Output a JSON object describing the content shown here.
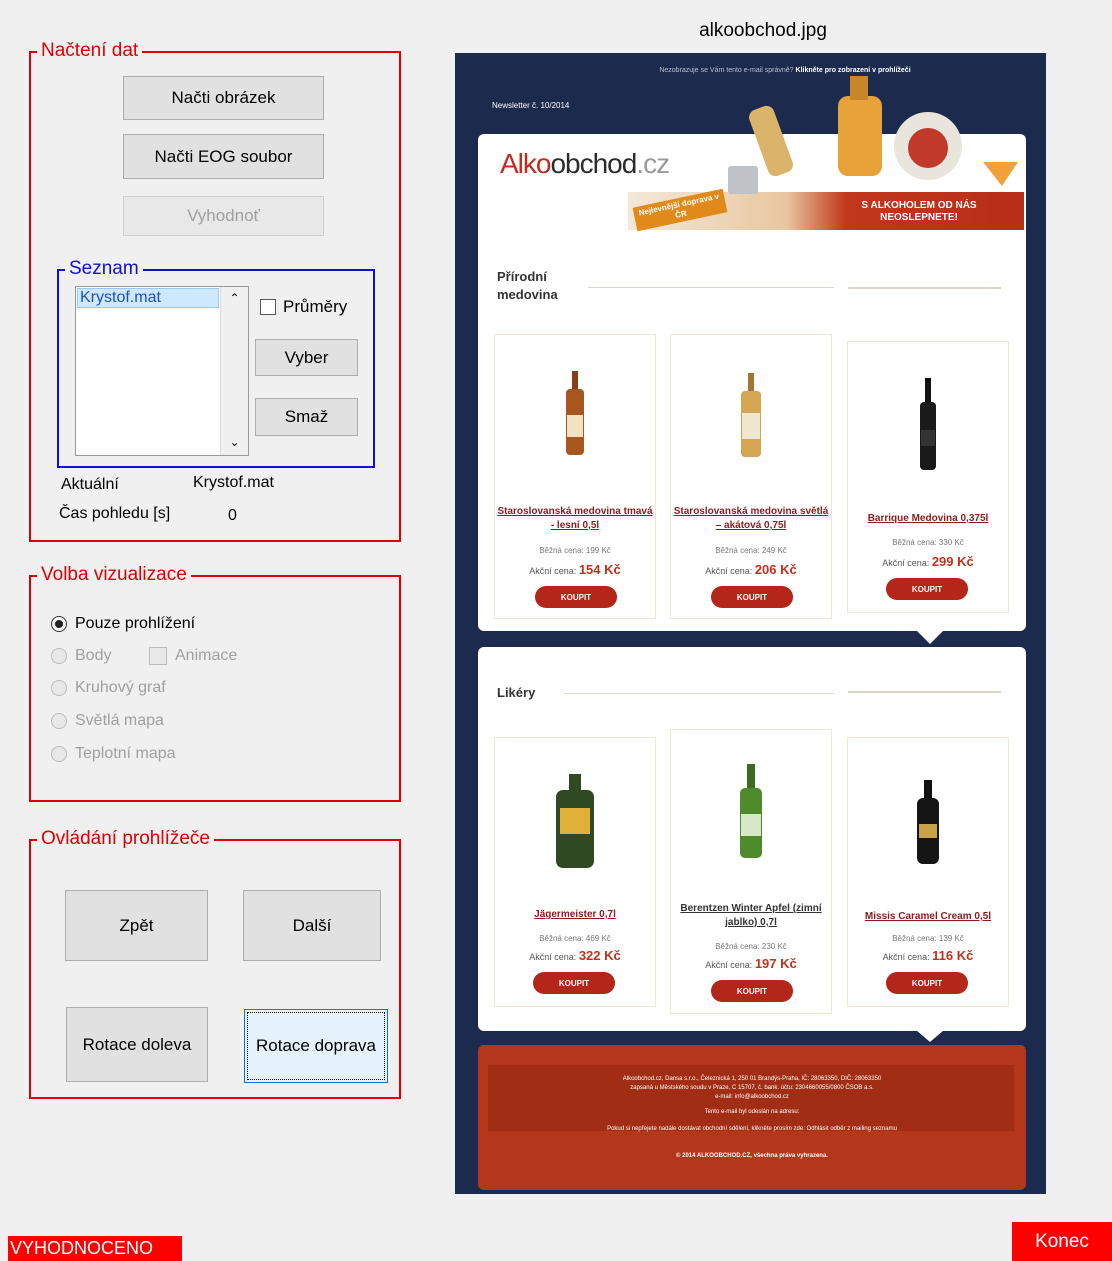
{
  "image_title": "alkoobchod.jpg",
  "nacteni": {
    "title": "Načtení dat",
    "btn_load_image": "Načti obrázek",
    "btn_load_eog": "Načti EOG soubor",
    "btn_evaluate": "Vyhodnoť",
    "seznam": {
      "title": "Seznam",
      "items": [
        "Krystof.mat"
      ],
      "chk_prumery": "Průměry",
      "btn_vyber": "Vyber",
      "btn_smaz": "Smaž"
    },
    "aktualni_label": "Aktuální",
    "aktualni_value": "Krystof.mat",
    "cas_label": "Čas pohledu [s]",
    "cas_value": "0"
  },
  "vizualizace": {
    "title": "Volba vizualizace",
    "options": [
      "Pouze prohlížení",
      "Body",
      "Kruhový graf",
      "Světlá mapa",
      "Teplotní mapa"
    ],
    "selected": "Pouze prohlížení",
    "chk_animace": "Animace"
  },
  "ovladani": {
    "title": "Ovládání prohlížeče",
    "btn_zpet": "Zpět",
    "btn_dalsi": "Další",
    "btn_rot_left": "Rotace doleva",
    "btn_rot_right": "Rotace doprava"
  },
  "status": "VYHODNOCENO",
  "btn_konec": "Konec",
  "newsletter": {
    "top_link_a": "Nezobrazuje se Vám tento e-mail správně?",
    "top_link_b": "Klikněte pro zobrazení v prohlížeči",
    "issue": "Newsletter č. 10/2014",
    "logo_a": "Alko",
    "logo_b": "obchod",
    "logo_c": ".cz",
    "promo_badge": "Nejlevnější doprava v ČR",
    "promo_banner": "S ALKOHOLEM OD NÁS NEOSLEPNETE!",
    "sections": [
      {
        "title": "Přírodní medovina",
        "products": [
          {
            "name": "Staroslovanská medovina tmavá - lesní 0,5l",
            "regular": "Běžná cena: 199 Kč",
            "sale_label": "Akční cena:",
            "sale_price": "154 Kč",
            "button": "KOUPIT",
            "bottle_color": "#a8561f"
          },
          {
            "name": "Staroslovanská medovina světlá – akátová 0,75l",
            "regular": "Běžná cena: 249 Kč",
            "sale_label": "Akční cena:",
            "sale_price": "206 Kč",
            "button": "KOUPIT",
            "bottle_color": "#d4a553"
          },
          {
            "name": "Barrique Medovina 0,375l",
            "regular": "Běžná cena: 330 Kč",
            "sale_label": "Akční cena:",
            "sale_price": "299 Kč",
            "button": "KOUPIT",
            "bottle_color": "#1a1a1a"
          }
        ]
      },
      {
        "title": "Likéry",
        "products": [
          {
            "name": "Jägermeister 0,7l",
            "regular": "Běžná cena: 469 Kč",
            "sale_label": "Akční cena:",
            "sale_price": "322 Kč",
            "button": "KOUPIT",
            "bottle_color": "#2f4a23"
          },
          {
            "name": "Berentzen Winter Apfel (zimní jablko) 0,7l",
            "regular": "Běžná cena: 230 Kč",
            "sale_label": "Akční cena:",
            "sale_price": "197 Kč",
            "button": "KOUPIT",
            "bottle_color": "#4f8a2c"
          },
          {
            "name": "Missis Caramel Cream 0,5l",
            "regular": "Běžná cena: 139 Kč",
            "sale_label": "Akční cena:",
            "sale_price": "116 Kč",
            "button": "KOUPIT",
            "bottle_color": "#151515"
          }
        ]
      }
    ],
    "footer_lines": [
      "Alkoobchod.cz, Dansa s.r.o., Čeleznická 1, 250 01 Brandýs-Praha, IČ: 28063350, DIČ: 28063350",
      "zapsaná u Městského soudu v Praze, C 15707, č. bank. účtu: 2304660055/0800 ČSOB a.s.",
      "e-mail: info@alkoobchod.cz",
      "Tento e-mail byl odeslán na adresu:",
      "Pokud si nepřejete nadále dostávat obchodní sdělení, klikněte prosím zde: Odhlásit odběr z mailing seznamu",
      "© 2014 ALKOOBCHOD.CZ, všechna práva vyhrazena."
    ],
    "colors": {
      "navy": "#1c2a4d",
      "footer": "#b5371b",
      "accent": "#c0321e"
    }
  }
}
